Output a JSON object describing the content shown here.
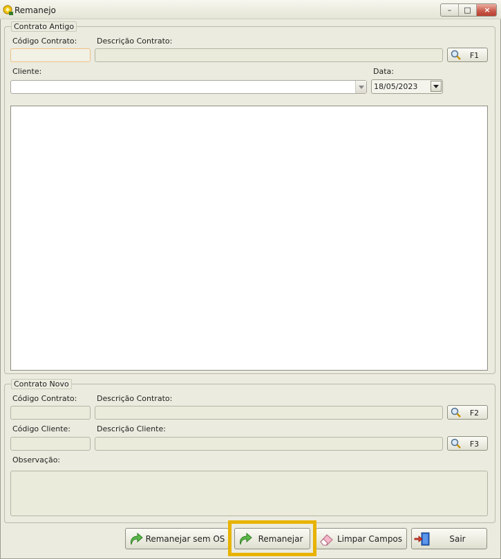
{
  "window": {
    "title": "Remanejo",
    "minimize": "–",
    "maximize": "□",
    "close": "×",
    "icon": "app-logo-icon"
  },
  "old_contract": {
    "legend": "Contrato Antigo",
    "code_label": "Código Contrato:",
    "code_value": "",
    "description_label": "Descrição Contrato:",
    "description_value": "",
    "search_button": "F1",
    "client_label": "Cliente:",
    "client_value": "",
    "date_label": "Data:",
    "date_value": "18/05/2023"
  },
  "new_contract": {
    "legend": "Contrato Novo",
    "code_label": "Código Contrato:",
    "code_value": "",
    "description_label": "Descrição Contrato:",
    "description_value": "",
    "contract_search_button": "F2",
    "client_code_label": "Código Cliente:",
    "client_code_value": "",
    "client_description_label": "Descrição Cliente:",
    "client_description_value": "",
    "client_search_button": "F3",
    "observation_label": "Observação:",
    "observation_value": ""
  },
  "actions": {
    "remanejar_sem_os": "Remanejar sem OS",
    "remanejar": "Remanejar",
    "limpar_campos": "Limpar Campos",
    "sair": "Sair"
  },
  "colors": {
    "highlight": "#e8b300",
    "active_border": "#f0c083",
    "form_bg": "#ebebdf"
  }
}
